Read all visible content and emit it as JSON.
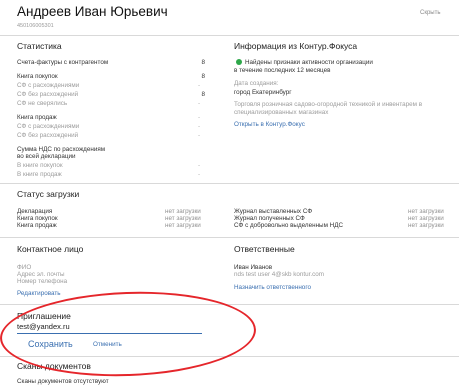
{
  "header": {
    "name": "Андреев Иван Юрьевич",
    "inn": "450106005301",
    "hide": "Скрыть"
  },
  "stats": {
    "title": "Статистика",
    "invoices": {
      "label": "Счета-фактуры с контрагентом",
      "value": "8"
    },
    "purchases": {
      "label": "Книга покупок",
      "value": "8"
    },
    "purchases_diff": {
      "label": "СФ с расхождениями",
      "value": "-"
    },
    "purchases_nodiff": {
      "label": "СФ без расхождений",
      "value": "8"
    },
    "purchases_unmatched": {
      "label": "СФ не сверялись",
      "value": "-"
    },
    "sales": {
      "label": "Книга продаж",
      "value": "-"
    },
    "sales_diff": {
      "label": "СФ с расхождениями",
      "value": "-"
    },
    "sales_nodiff": {
      "label": "СФ без расхождений",
      "value": "-"
    },
    "vat_line1": "Сумма НДС по расхождениям",
    "vat_line2": "во всей декларации",
    "vat_purchases": {
      "label": "В книге покупок",
      "value": "-"
    },
    "vat_sales": {
      "label": "В книге продаж",
      "value": "-"
    }
  },
  "focus": {
    "title": "Информация из Контур.Фокуса",
    "status_line1": "Найдены признаки активности организации",
    "status_line2": "в течение последних 12 месяцев",
    "created_label": "Дата создания:",
    "city": "город Екатеринбург",
    "desc_line1": "Торговля розничная садово-огородной техникой и инвентарем в",
    "desc_line2": "специализированных магазинах",
    "open_link": "Открыть в Контур.Фокус"
  },
  "upload": {
    "title": "Статус загрузки",
    "left": [
      {
        "label": "Декларация",
        "status": "нет загрузки"
      },
      {
        "label": "Книга покупок",
        "status": "нет загрузки"
      },
      {
        "label": "Книга продаж",
        "status": "нет загрузки"
      }
    ],
    "right": [
      {
        "label": "Журнал выставленных СФ",
        "status": "нет загрузки"
      },
      {
        "label": "Журнал полученных СФ",
        "status": "нет загрузки"
      },
      {
        "label": "СФ с добровольно выделенным НДС",
        "status": "нет загрузки"
      }
    ]
  },
  "contact": {
    "title": "Контактное лицо",
    "fio": "ФИО",
    "email": "Адрес эл. почты",
    "phone": "Номер телефона",
    "edit": "Редактировать"
  },
  "responsible": {
    "title": "Ответственные",
    "name": "Иван Иванов",
    "email": "nds test user 4@skb kontur.com",
    "assign": "Назначить ответственного"
  },
  "invite": {
    "title": "Приглашение",
    "value": "test@yandex.ru",
    "save": "Сохранить",
    "cancel": "Отменить"
  },
  "scans": {
    "title": "Сканы документов",
    "empty": "Сканы документов отсутствуют"
  },
  "colors": {
    "link": "#3a6fb0",
    "active_dot": "#2ea84a",
    "annotation": "#e5262b"
  }
}
